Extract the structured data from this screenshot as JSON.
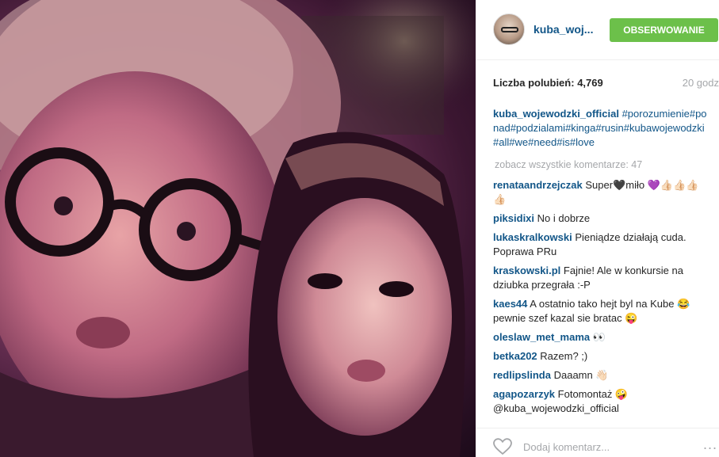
{
  "post": {
    "image_alt": "",
    "author": "kuba_woj...",
    "follow_label": "OBSERWOWANIE",
    "likes_label": "Liczba polubień:",
    "likes_count": "4,769",
    "time": "20 godz",
    "caption_user": "kuba_wojewodzki_official",
    "caption_text": "#porozumienie#ponad#podzialami#kinga#rusin#kubawojewodzki#all#we#need#is#love",
    "view_all": "zobacz wszystkie komentarze: 47",
    "comments": [
      {
        "user": "renataandrzejczak",
        "text": "Super🖤miło 💜👍🏻👍🏻👍🏻👍🏻"
      },
      {
        "user": "piksidixi",
        "text": "No i dobrze"
      },
      {
        "user": "lukaskralkowski",
        "text": "Pieniądze działają cuda. Poprawa PRu"
      },
      {
        "user": "kraskowski.pl",
        "text": "Fajnie! Ale w konkursie na dziubka przegrała :-P"
      },
      {
        "user": "kaes44",
        "text": "A ostatnio tako hejt byl na Kube 😂 pewnie szef kazal sie bratac 😜"
      },
      {
        "user": "oleslaw_met_mama",
        "text": "👀"
      },
      {
        "user": "betka202",
        "text": "Razem? ;)"
      },
      {
        "user": "redlipslinda",
        "text": "Daaamn 👋🏻"
      },
      {
        "user": "agapozarzyk",
        "text": "Fotomontaż 🤪 @kuba_wojewodzki_official"
      }
    ],
    "comment_placeholder": "Dodaj komentarz...",
    "more_label": "..."
  },
  "icons": {
    "heart": "heart-icon",
    "more": "more-options-icon"
  },
  "colors": {
    "link": "#125688",
    "follow_button": "#6cc04a",
    "muted": "#a5a7aa"
  }
}
